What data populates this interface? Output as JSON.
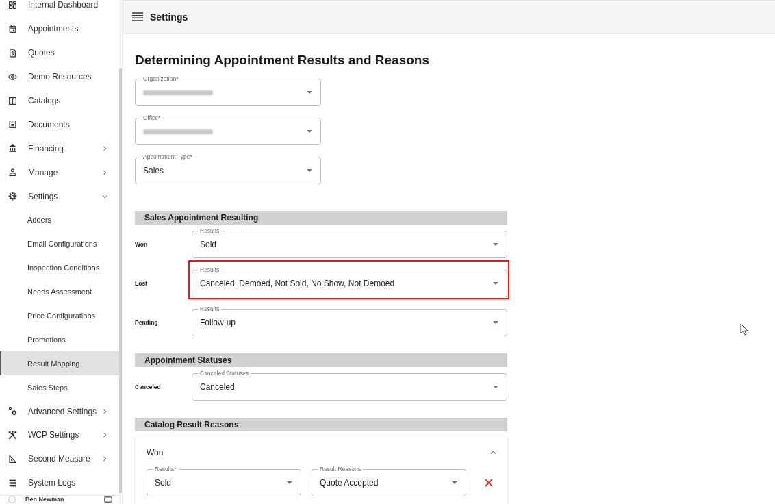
{
  "sidebar": {
    "items": [
      {
        "label": "Internal Dashboard",
        "selected": false
      },
      {
        "label": "Appointments",
        "selected": false
      },
      {
        "label": "Quotes",
        "selected": false
      },
      {
        "label": "Demo Resources",
        "selected": false
      },
      {
        "label": "Catalogs",
        "selected": false
      },
      {
        "label": "Documents",
        "selected": false
      },
      {
        "label": "Financing",
        "selected": false,
        "expanded": false
      },
      {
        "label": "Manage",
        "selected": false,
        "expanded": false
      },
      {
        "label": "Settings",
        "selected": false,
        "expanded": true,
        "children": [
          {
            "label": "Adders",
            "selected": false
          },
          {
            "label": "Email Configurations",
            "selected": false
          },
          {
            "label": "Inspection Conditions",
            "selected": false
          },
          {
            "label": "Needs Assessment",
            "selected": false
          },
          {
            "label": "Price Configurations",
            "selected": false
          },
          {
            "label": "Promotions",
            "selected": false
          },
          {
            "label": "Result Mapping",
            "selected": true
          },
          {
            "label": "Sales Steps",
            "selected": false
          }
        ]
      },
      {
        "label": "Advanced Settings",
        "selected": false,
        "expanded": false
      },
      {
        "label": "WCP Settings",
        "selected": false,
        "expanded": false
      },
      {
        "label": "Second Measure",
        "selected": false,
        "expanded": false
      },
      {
        "label": "System Logs",
        "selected": false
      }
    ],
    "user": {
      "name": "Ben Newman"
    }
  },
  "app_bar": {
    "title": "Settings"
  },
  "page": {
    "title": "Determining Appointment Results and Reasons"
  },
  "filters": [
    {
      "label": "Organization*",
      "redacted": true
    },
    {
      "label": "Office*",
      "redacted": true
    },
    {
      "label": "Appointment Type*",
      "redacted": false,
      "value": "Sales"
    }
  ],
  "sections": [
    {
      "title": "Sales Appointment Resulting",
      "kind": "mapping",
      "rows": [
        {
          "label": "Won",
          "field_label": "Results",
          "value": "Sold",
          "highlighted": false
        },
        {
          "label": "Lost",
          "field_label": "Results",
          "value": "Canceled, Demoed, Not Sold, No Show, Not Demoed",
          "highlighted": true
        },
        {
          "label": "Pending",
          "field_label": "Results",
          "value": "Follow-up",
          "highlighted": false
        }
      ]
    },
    {
      "title": "Appointment Statuses",
      "kind": "mapping",
      "rows": [
        {
          "label": "Canceled",
          "field_label": "Canceled Statuses",
          "value": "Canceled",
          "highlighted": false
        }
      ]
    },
    {
      "title": "Catalog Result Reasons",
      "kind": "reasons",
      "groups": [
        {
          "title": "Won",
          "expanded": true,
          "entries": [
            {
              "results_label": "Results*",
              "results_value": "Sold",
              "reasons_label": "Result Reasons",
              "reasons_value": "Quote Accepted"
            }
          ]
        }
      ]
    }
  ]
}
